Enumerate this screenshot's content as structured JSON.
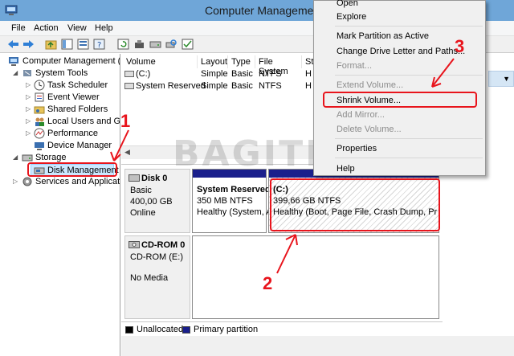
{
  "window": {
    "title": "Computer Management"
  },
  "menu": [
    {
      "label": "File"
    },
    {
      "label": "Action"
    },
    {
      "label": "View"
    },
    {
      "label": "Help"
    }
  ],
  "tree": {
    "root": "Computer Management (L",
    "system_tools": "System Tools",
    "task_scheduler": "Task Scheduler",
    "event_viewer": "Event Viewer",
    "shared_folders": "Shared Folders",
    "local_users": "Local Users and Gro",
    "performance": "Performance",
    "device_manager": "Device Manager",
    "storage": "Storage",
    "disk_management": "Disk Management",
    "services": "Services and Applicatio"
  },
  "volume_list": {
    "columns": [
      "Volume",
      "Layout",
      "Type",
      "File System",
      "St"
    ],
    "rows": [
      {
        "volume": "(C:)",
        "layout": "Simple",
        "type": "Basic",
        "fs": "NTFS",
        "status": "H"
      },
      {
        "volume": "System Reserved",
        "layout": "Simple",
        "type": "Basic",
        "fs": "NTFS",
        "status": "H"
      }
    ]
  },
  "disks": [
    {
      "name": "Disk 0",
      "kind": "Basic",
      "size": "400,00 GB",
      "state": "Online",
      "partitions": [
        {
          "name": "System Reserved",
          "size": "350 MB NTFS",
          "status": "Healthy (System, A"
        },
        {
          "name": "(C:)",
          "size": "399,66 GB NTFS",
          "status": "Healthy (Boot, Page File, Crash Dump, Primar"
        }
      ]
    },
    {
      "name": "CD-ROM 0",
      "kind": "CD-ROM (E:)",
      "state": "No Media"
    }
  ],
  "legend": {
    "unallocated": "Unallocated",
    "primary": "Primary partition"
  },
  "context_menu": {
    "open": "Open",
    "explore": "Explore",
    "mark_active": "Mark Partition as Active",
    "change_letter": "Change Drive Letter and Paths...",
    "format": "Format...",
    "extend": "Extend Volume...",
    "shrink": "Shrink Volume...",
    "add_mirror": "Add Mirror...",
    "delete": "Delete Volume...",
    "properties": "Properties",
    "help": "Help"
  },
  "annotations": {
    "n1": "1",
    "n2": "2",
    "n3": "3"
  },
  "watermark": "BAGITEKNO",
  "colors": {
    "titlebar": "#6fa6d8",
    "primary_partition": "#1a1f8c",
    "annotation_red": "#e8141c",
    "selection": "#cce8ff"
  }
}
